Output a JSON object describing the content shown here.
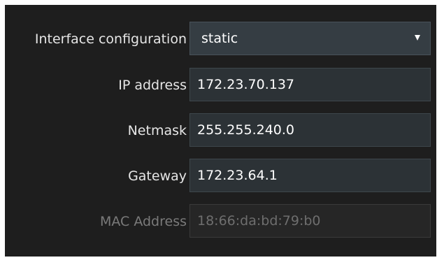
{
  "interface_configuration": {
    "label": "Interface configuration",
    "selected": "static"
  },
  "ip_address": {
    "label": "IP address",
    "value": "172.23.70.137"
  },
  "netmask": {
    "label": "Netmask",
    "value": "255.255.240.0"
  },
  "gateway": {
    "label": "Gateway",
    "value": "172.23.64.1"
  },
  "mac_address": {
    "label": "MAC Address",
    "value": "18:66:da:bd:79:b0"
  }
}
